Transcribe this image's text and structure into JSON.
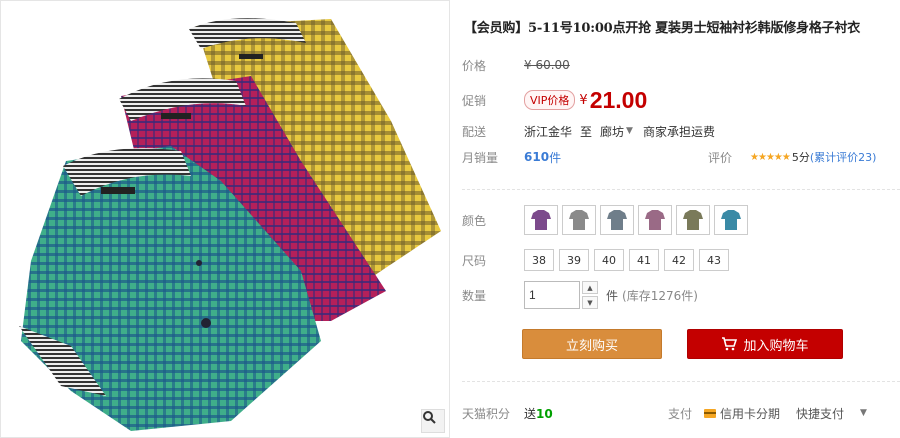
{
  "product": {
    "title": "【会员购】5-11号10:00点开抢 夏装男士短袖衬衫韩版修身格子衬衣",
    "price_label": "价格",
    "original_price": "¥ 60.00",
    "promo_label": "促销",
    "vip_tag": "VIP价格",
    "currency": "¥",
    "promo_price": "21.00",
    "shipping_label": "配送",
    "ship_from": "浙江金华",
    "ship_sep": "至",
    "ship_to": "廊坊",
    "ship_fee": "商家承担运费",
    "sales_label": "月销量",
    "sales_count": "610",
    "sales_unit": "件",
    "rating_label": "评价",
    "stars": "★★★★★",
    "rating_score": "5分",
    "review_count": "(累计评价23)"
  },
  "options": {
    "color_label": "颜色",
    "colors": [
      "purple",
      "gray",
      "slate",
      "mauve",
      "olive",
      "teal"
    ],
    "size_label": "尺码",
    "sizes": [
      "38",
      "39",
      "40",
      "41",
      "42",
      "43"
    ],
    "qty_label": "数量",
    "qty_value": "1",
    "qty_unit": "件",
    "stock_text": "(库存1276件)"
  },
  "actions": {
    "buy_now": "立刻购买",
    "add_to_cart": "加入购物车"
  },
  "footer": {
    "points_label": "天猫积分",
    "points_prefix": "送",
    "points_value": "10",
    "pay_label": "支付",
    "credit_card": "信用卡分期",
    "express": "快捷支付"
  },
  "swatch_colors": {
    "purple": "#7c4a8c",
    "gray": "#8a8a8a",
    "slate": "#6f7e8a",
    "mauve": "#9a6a86",
    "olive": "#7a7a5a",
    "teal": "#3a8aa6"
  }
}
